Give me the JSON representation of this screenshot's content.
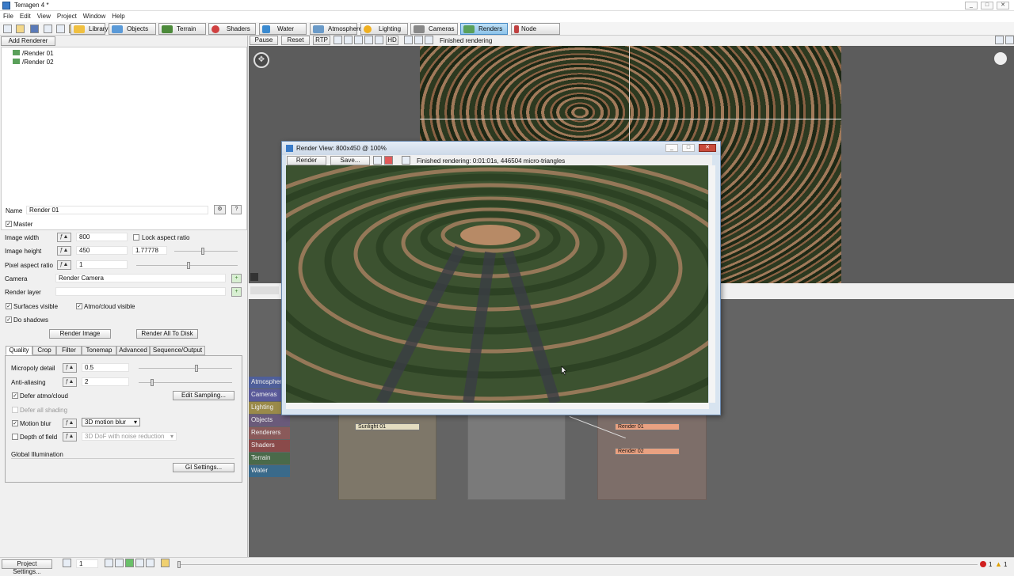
{
  "window": {
    "title": "Terragen 4 *"
  },
  "menu": [
    "File",
    "Edit",
    "View",
    "Project",
    "Window",
    "Help"
  ],
  "tabs": [
    {
      "label": "Library",
      "color": "#f0c040"
    },
    {
      "label": "Objects",
      "color": "#5a9ad8"
    },
    {
      "label": "Terrain",
      "color": "#4c8a3a"
    },
    {
      "label": "Shaders",
      "color": "#d04040"
    },
    {
      "label": "Water",
      "color": "#3a8ad0"
    },
    {
      "label": "Atmosphere",
      "color": "#6a9ac8"
    },
    {
      "label": "Lighting",
      "color": "#f0b020"
    },
    {
      "label": "Cameras",
      "color": "#888888"
    },
    {
      "label": "Renders",
      "color": "#5aa05a",
      "active": true
    },
    {
      "label": "Node Network",
      "color": "#c04040"
    }
  ],
  "render_toolbar": {
    "pause": "Pause",
    "reset": "Reset",
    "rtp": "RTP",
    "hd": "HD",
    "status": "Finished rendering"
  },
  "left": {
    "add_renderer": "Add Renderer",
    "renders": [
      "/Render 01",
      "/Render 02"
    ],
    "name_label": "Name",
    "name_value": "Render 01",
    "master": "Master",
    "image_width": "Image width",
    "width_value": "800",
    "lock_aspect": "Lock aspect ratio",
    "image_height": "Image height",
    "height_value": "450",
    "aspect_value": "1.77778",
    "pixel_aspect": "Pixel aspect ratio",
    "pixel_aspect_value": "1",
    "camera": "Camera",
    "camera_value": "Render Camera",
    "render_layer": "Render layer",
    "surfaces_visible": "Surfaces visible",
    "atmo_visible": "Atmo/cloud visible",
    "do_shadows": "Do shadows",
    "render_image": "Render Image",
    "render_all": "Render All To Disk",
    "param_tabs": [
      "Quality",
      "Crop",
      "Filter",
      "Tonemap",
      "Advanced",
      "Sequence/Output"
    ],
    "micropoly": "Micropoly detail",
    "micropoly_value": "0.5",
    "antialiasing": "Anti-aliasing",
    "antialiasing_value": "2",
    "defer_atmo": "Defer atmo/cloud",
    "edit_sampling": "Edit Sampling...",
    "defer_all": "Defer all shading",
    "motion_blur": "Motion blur",
    "motion_blur_value": "3D motion blur",
    "dof": "Depth of field",
    "dof_value": "3D DoF with noise reduction",
    "gi": "Global Illumination",
    "gi_settings": "GI Settings..."
  },
  "render_view": {
    "title": "Render View: 800x450 @ 100%",
    "render": "Render",
    "save": "Save...",
    "status": "Finished rendering: 0:01:01s, 446504 micro-triangles"
  },
  "node_sidebar": [
    "Atmosphere",
    "Cameras",
    "Lighting",
    "Objects",
    "Renderers",
    "Shaders",
    "Terrain",
    "Water"
  ],
  "nodes": {
    "sunlight": "Sunlight 01",
    "render1": "Render 01",
    "render2": "Render 02"
  },
  "statusbar": {
    "project_settings": "Project Settings...",
    "frame": "1",
    "errors": "1",
    "warnings": "1"
  }
}
